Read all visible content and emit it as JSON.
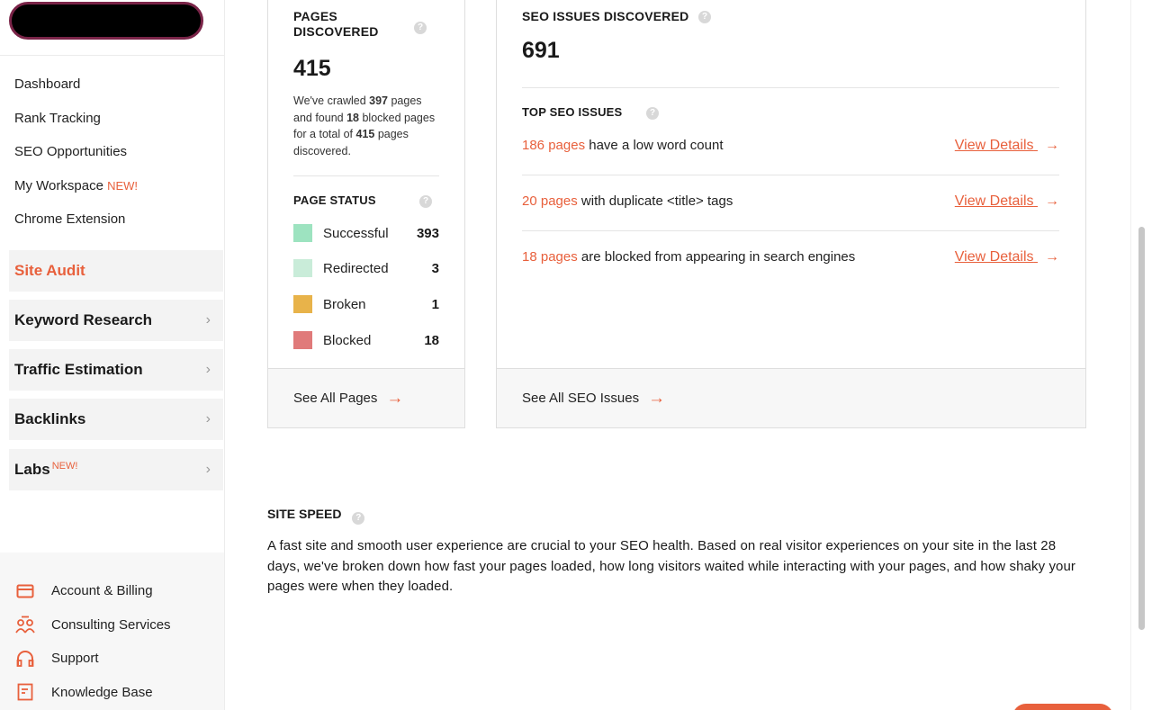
{
  "sidebar": {
    "links": [
      {
        "label": "Dashboard"
      },
      {
        "label": "Rank Tracking"
      },
      {
        "label": "SEO Opportunities"
      },
      {
        "label": "My Workspace",
        "badge": "NEW!"
      },
      {
        "label": "Chrome Extension"
      }
    ],
    "sections": [
      {
        "label": "Site Audit",
        "active": true
      },
      {
        "label": "Keyword Research"
      },
      {
        "label": "Traffic Estimation"
      },
      {
        "label": "Backlinks"
      },
      {
        "label": "Labs",
        "badge": "NEW!"
      }
    ],
    "chevron": "›",
    "bottom": [
      {
        "label": "Account & Billing",
        "icon": "credit-card-icon"
      },
      {
        "label": "Consulting Services",
        "icon": "people-icon"
      },
      {
        "label": "Support",
        "icon": "headset-icon"
      },
      {
        "label": "Knowledge Base",
        "icon": "document-icon"
      }
    ]
  },
  "pages_card": {
    "title_line1": "PAGES",
    "title_line2": "DISCOVERED",
    "total": "415",
    "desc_a": "We've crawled ",
    "crawled": "397",
    "desc_b": " pages and found ",
    "blocked": "18",
    "desc_c": " blocked pages for a total of ",
    "total_inline": "415",
    "desc_d": " pages discovered.",
    "status_title": "PAGE STATUS",
    "statuses": [
      {
        "label": "Successful",
        "count": "393",
        "color": "#9de3c0"
      },
      {
        "label": "Redirected",
        "count": "3",
        "color": "#c9ecd9"
      },
      {
        "label": "Broken",
        "count": "1",
        "color": "#e8b34a"
      },
      {
        "label": "Blocked",
        "count": "18",
        "color": "#e07a7a"
      }
    ],
    "footer": "See All Pages",
    "arrow": "→"
  },
  "seo_card": {
    "title": "SEO ISSUES DISCOVERED",
    "total": "691",
    "top_title": "TOP SEO ISSUES",
    "issues": [
      {
        "count": "186 pages",
        "text": " have a low word count",
        "link": "View Details"
      },
      {
        "count": "20 pages",
        "text": " with duplicate <title> tags",
        "link": "View Details"
      },
      {
        "count": "18 pages",
        "text": " are blocked from appearing in search engines",
        "link": "View Details"
      }
    ],
    "footer": "See All SEO Issues",
    "arrow": "→"
  },
  "site_speed": {
    "title": "SITE SPEED",
    "text": "A fast site and smooth user experience are crucial to your SEO health. Based on real visitor experiences on your site in the last 28 days, we've broken down how fast your pages loaded, how long visitors waited while interacting with your pages, and how shaky your pages were when they loaded."
  },
  "help_glyph": "?",
  "colors": {
    "accent": "#e8603c"
  }
}
